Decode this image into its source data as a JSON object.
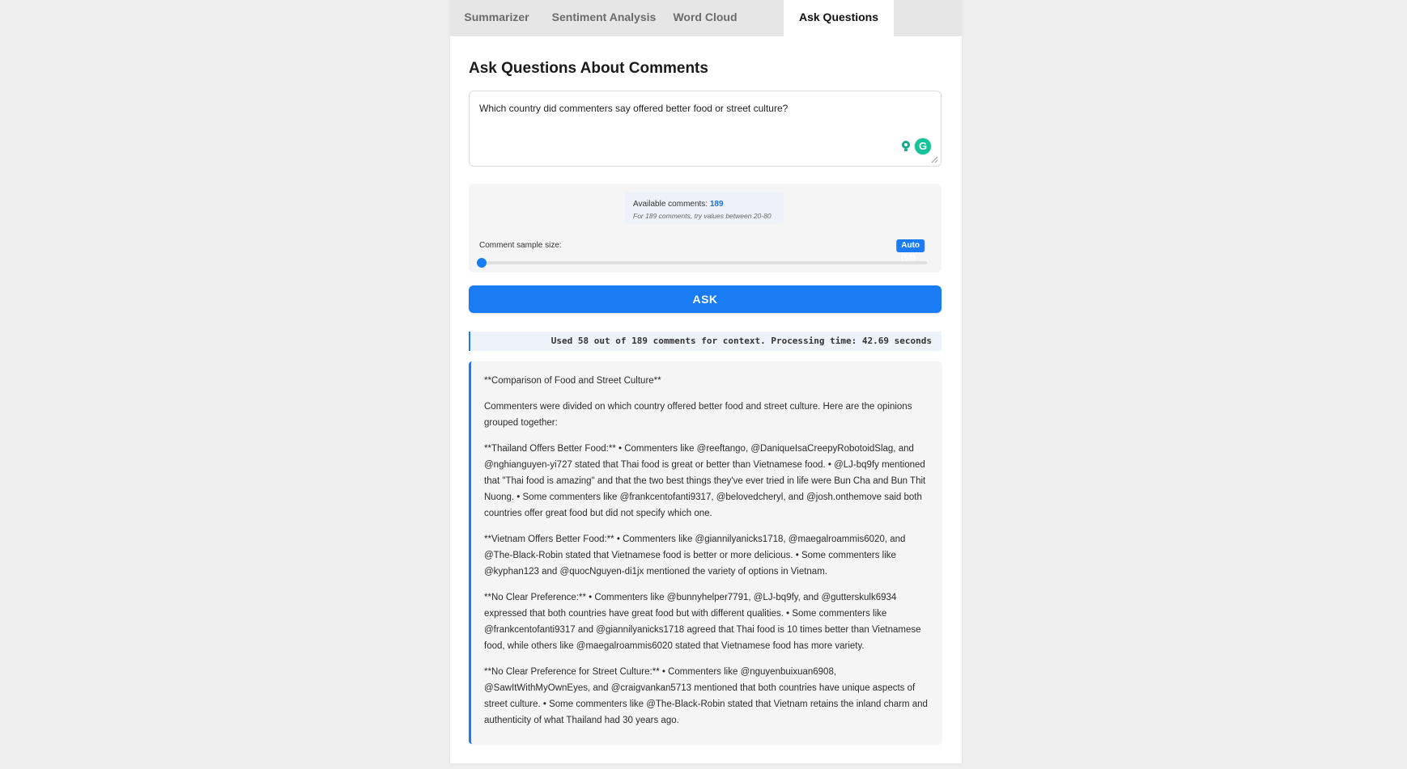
{
  "tabs": [
    {
      "label": "Summarizer",
      "active": false
    },
    {
      "label": "Sentiment Analysis",
      "active": false
    },
    {
      "label": "Word Cloud",
      "active": false
    },
    {
      "label": "Ask Questions",
      "active": true
    }
  ],
  "page_title": "Ask Questions About Comments",
  "question": {
    "value": "Which country did commenters say offered better food or street culture?"
  },
  "sample": {
    "available_label": "Available comments:",
    "available_count": "189",
    "hint": "For 189 comments, try values between 20-80",
    "size_label": "Comment sample size:",
    "badge": "Auto (58)",
    "slider_fraction": 0.0
  },
  "ask_label": "ASK",
  "status_text": "Used 58 out of 189 comments for context. Processing time: 42.69 seconds",
  "answer": {
    "paragraphs": [
      "**Comparison of Food and Street Culture**",
      "Commenters were divided on which country offered better food and street culture. Here are the opinions grouped together:",
      "**Thailand Offers Better Food:** • Commenters like @reeftango, @DaniqueIsaCreepyRobotoidSlag, and @nghianguyen-yi727 stated that Thai food is great or better than Vietnamese food. • @LJ-bq9fy mentioned that \"Thai food is amazing\" and that the two best things they've ever tried in life were Bun Cha and Bun Thit Nuong. • Some commenters like @frankcentofanti9317, @belovedcheryl, and @josh.onthemove said both countries offer great food but did not specify which one.",
      "**Vietnam Offers Better Food:** • Commenters like @giannilyanicks1718, @maegalroammis6020, and @The-Black-Robin stated that Vietnamese food is better or more delicious. • Some commenters like @kyphan123 and @quocNguyen-di1jx mentioned the variety of options in Vietnam.",
      "**No Clear Preference:** • Commenters like @bunnyhelper7791, @LJ-bq9fy, and @gutterskulk6934 expressed that both countries have great food but with different qualities. • Some commenters like @frankcentofanti9317 and @giannilyanicks1718 agreed that Thai food is 10 times better than Vietnamese food, while others like @maegalroammis6020 stated that Vietnamese food has more variety.",
      "**No Clear Preference for Street Culture:** • Commenters like @nguyenbuixuan6908, @SawItWithMyOwnEyes, and @craigvankan5713 mentioned that both countries have unique aspects of street culture. • Some commenters like @The-Black-Robin stated that Vietnam retains the inland charm and authenticity of what Thailand had 30 years ago."
    ]
  },
  "colors": {
    "accent": "#1a7cf5",
    "page_bg": "#efefef",
    "panel_bg": "#ffffff"
  },
  "icons": [
    "grammarly-bulb-icon",
    "grammarly-g-icon",
    "resize-grip-icon"
  ]
}
